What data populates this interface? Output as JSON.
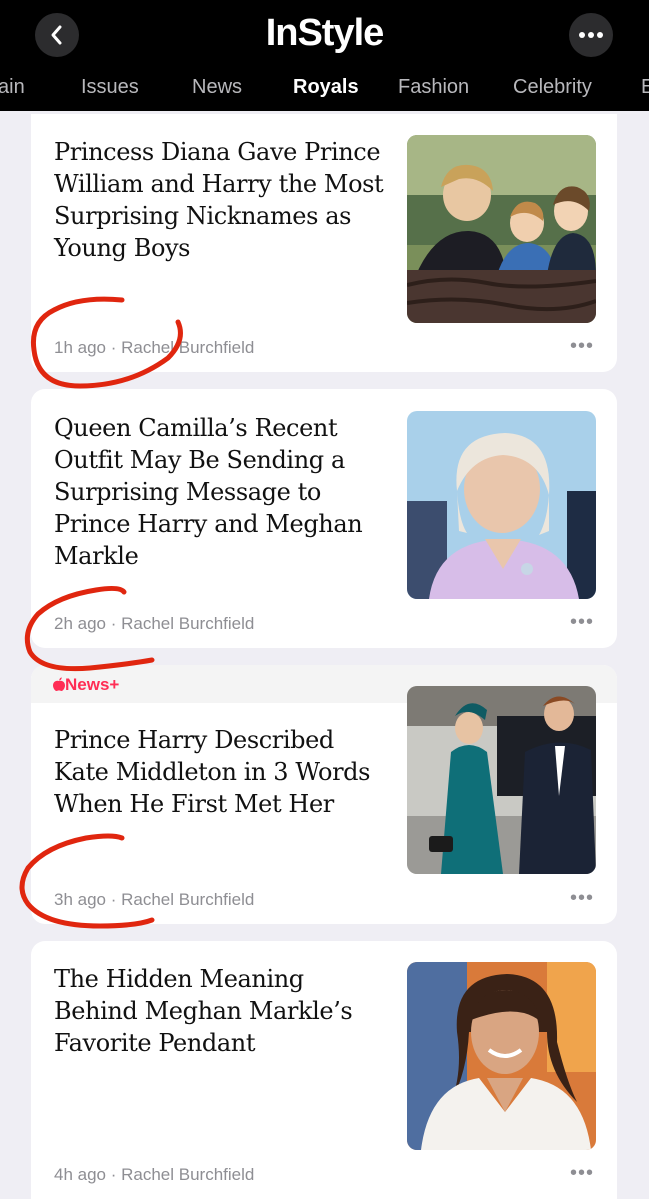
{
  "header": {
    "logo": "InStyle",
    "back_icon": "chevron-left-icon",
    "more_icon": "ellipsis-icon",
    "tabs": [
      "ain",
      "Issues",
      "News",
      "Royals",
      "Fashion",
      "Celebrity",
      "E"
    ],
    "active_tab": "Royals"
  },
  "articles": [
    {
      "headline": "Princess Diana Gave Prince William and Harry the Most Surprising Nicknames as Young Boys",
      "time": "1h ago",
      "author": "Rachel Burchfield",
      "meta": "1h ago · Rachel Burchfield"
    },
    {
      "headline": "Queen Camilla’s Recent Outfit May Be Sending a Surprising Message to Prince Harry and Meghan Markle",
      "time": "2h ago",
      "author": "Rachel Burchfield",
      "meta": "2h ago · Rachel Burchfield"
    },
    {
      "badge": "News+",
      "headline": "Prince Harry Described Kate Middleton in 3 Words When He First Met Her",
      "time": "3h ago",
      "author": "Rachel Burchfield",
      "meta": "3h ago · Rachel Burchfield"
    },
    {
      "headline": "The Hidden Meaning Behind Meghan Markle’s Favorite Pendant",
      "time": "4h ago",
      "author": "Rachel Burchfield",
      "meta": "4h ago · Rachel Burchfield"
    }
  ],
  "more_label": "•••",
  "colors": {
    "accent_red": "#ff2d55",
    "annotation_red": "#e0260f",
    "header_bg": "#000000",
    "page_bg": "#efeef4"
  }
}
